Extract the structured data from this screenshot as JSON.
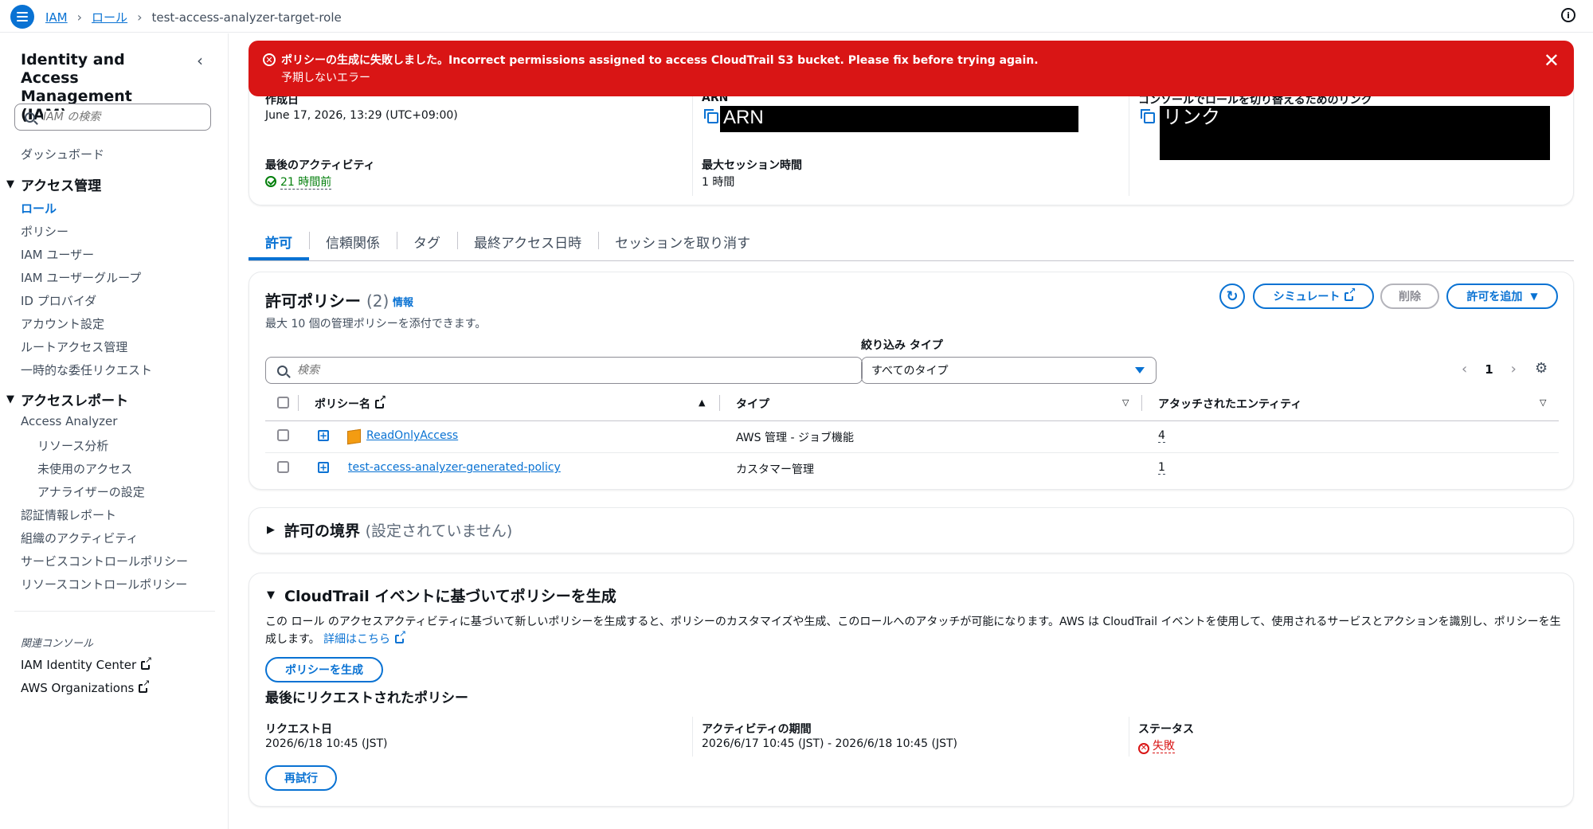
{
  "topbar": {
    "breadcrumbs": [
      "IAM",
      "ロール",
      "test-access-analyzer-target-role"
    ]
  },
  "sidebar": {
    "title": "Identity and Access Management (IAM)",
    "search_placeholder": "IAM の検索",
    "dashboard": "ダッシュボード",
    "access_mgmt": {
      "heading": "アクセス管理",
      "items": [
        "ロール",
        "ポリシー",
        "IAM ユーザー",
        "IAM ユーザーグループ",
        "ID プロバイダ",
        "アカウント設定",
        "ルートアクセス管理",
        "一時的な委任リクエスト"
      ]
    },
    "access_reports": {
      "heading": "アクセスレポート",
      "analyzer": "Access Analyzer",
      "analyzer_items": [
        "リソース分析",
        "未使用のアクセス",
        "アナライザーの設定"
      ],
      "items": [
        "認証情報レポート",
        "組織のアクティビティ",
        "サービスコントロールポリシー",
        "リソースコントロールポリシー"
      ]
    },
    "related": {
      "heading": "関連コンソール",
      "items": [
        "IAM Identity Center",
        "AWS Organizations"
      ]
    }
  },
  "error": {
    "title": "ポリシーの生成に失敗しました。Incorrect permissions assigned to access CloudTrail S3 bucket. Please fix before trying again.",
    "subtitle": "予期しないエラー"
  },
  "summary": {
    "created_label": "作成日",
    "created_value": "June 17, 2026, 13:29 (UTC+09:00)",
    "last_activity_label": "最後のアクティビティ",
    "last_activity_value": "21 時間前",
    "arn_label": "ARN",
    "arn_value": "ARN",
    "max_session_label": "最大セッション時間",
    "max_session_value": "1 時間",
    "switch_link_label": "コンソールでロールを切り替えるためのリンク",
    "switch_link_value": "リンク"
  },
  "tabs": [
    "許可",
    "信頼関係",
    "タグ",
    "最終アクセス日時",
    "セッションを取り消す"
  ],
  "policies": {
    "title": "許可ポリシー",
    "count": "(2)",
    "info": "情報",
    "description": "最大 10 個の管理ポリシーを添付できます。",
    "simulate": "シミュレート",
    "delete": "削除",
    "add": "許可を追加",
    "search_placeholder": "検索",
    "filter_label": "絞り込み タイプ",
    "filter_value": "すべてのタイプ",
    "page": "1",
    "columns": [
      "ポリシー名",
      "タイプ",
      "アタッチされたエンティティ"
    ],
    "rows": [
      {
        "name": "ReadOnlyAccess",
        "type": "AWS 管理 - ジョブ機能",
        "entities": "4"
      },
      {
        "name": "test-access-analyzer-generated-policy",
        "type": "カスタマー管理",
        "entities": "1"
      }
    ]
  },
  "boundary": {
    "title": "許可の境界",
    "note": "(設定されていません)"
  },
  "cloudtrail": {
    "title": "CloudTrail イベントに基づいてポリシーを生成",
    "description": "この ロール のアクセスアクティビティに基づいて新しいポリシーを生成すると、ポリシーのカスタマイズや生成、このロールへのアタッチが可能になります。AWS は CloudTrail イベントを使用して、使用されるサービスとアクションを識別し、ポリシーを生成します。",
    "learn_more": "詳細はこちら",
    "generate_btn": "ポリシーを生成",
    "last_requested": "最後にリクエストされたポリシー",
    "request_date_label": "リクエスト日",
    "request_date_value": "2026/6/18 10:45 (JST)",
    "activity_label": "アクティビティの期間",
    "activity_value": "2026/6/17 10:45 (JST) - 2026/6/18 10:45 (JST)",
    "status_label": "ステータス",
    "status_value": "失敗",
    "retry_btn": "再試行"
  },
  "colors": {
    "accent": "#0972d3",
    "error": "#d91515",
    "success": "#037f0c"
  }
}
